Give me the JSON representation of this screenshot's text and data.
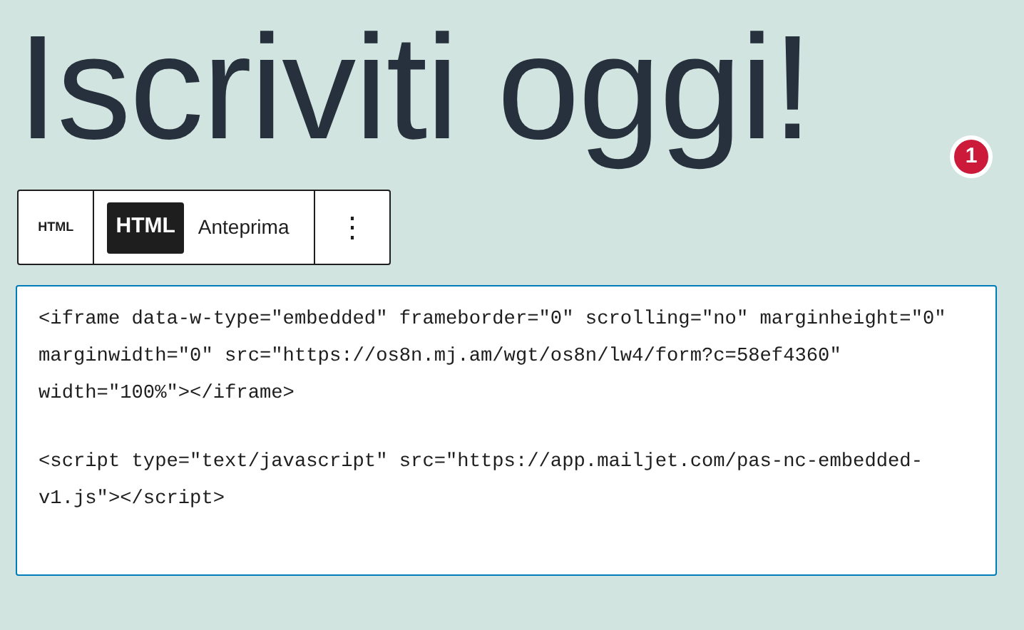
{
  "heading": "Iscriviti oggi!",
  "notice_badge": "1",
  "toolbar": {
    "block_label": "HTML",
    "tabs": [
      {
        "label": "HTML",
        "selected": true
      },
      {
        "label": "Anteprima",
        "selected": false
      }
    ],
    "more_icon": "⋮"
  },
  "code_blocks": [
    {
      "lines": [
        "<iframe data-w-type=\"embedded\" frameborder=\"0\" scrolling=\"no\" marginheight=\"0\"",
        "marginwidth=\"0\" src=\"https://os8n.mj.am/wgt/os8n/lw4/form?c=58ef4360\"",
        "width=\"100%\"></iframe>"
      ]
    },
    {
      "lines": [
        "<script type=\"text/javascript\" src=\"https://app.mailjet.com/pas-nc-embedded-",
        "v1.js\"></script>"
      ]
    }
  ]
}
